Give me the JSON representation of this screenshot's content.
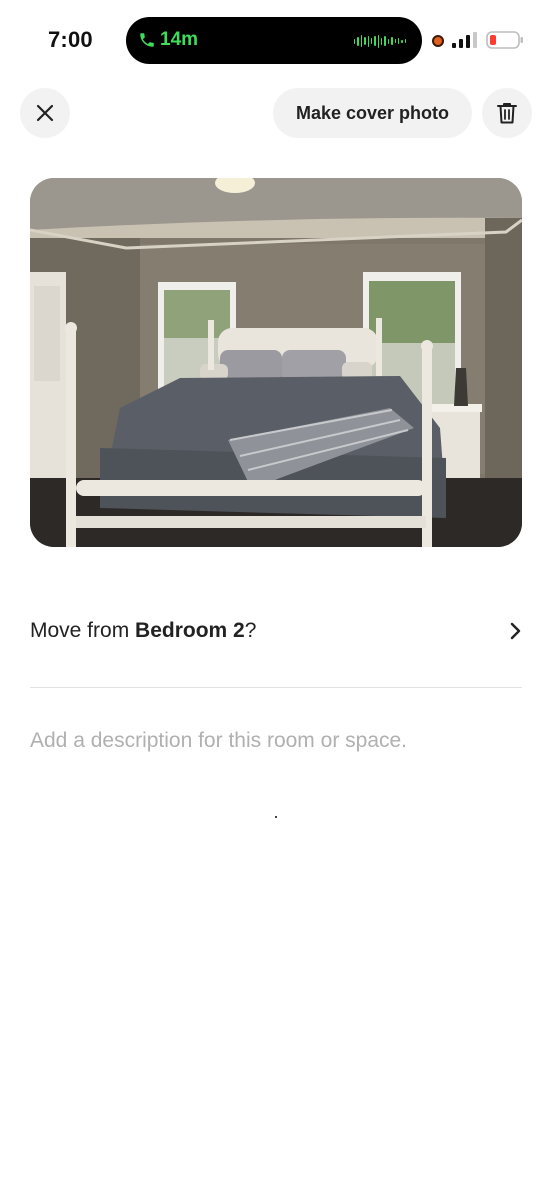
{
  "status_bar": {
    "time": "7:00",
    "call_duration": "14m",
    "call_color": "#3ddc5a",
    "battery_color": "#ff3b30"
  },
  "top_bar": {
    "close_icon": "close-icon",
    "cover_button_label": "Make cover photo",
    "trash_icon": "trash-icon"
  },
  "photo": {
    "subject": "bedroom-photo"
  },
  "move_row": {
    "prefix": "Move from ",
    "room": "Bedroom 2",
    "suffix": "?",
    "chevron_icon": "chevron-right-icon"
  },
  "description": {
    "placeholder": "Add a description for this room or space.",
    "value": ""
  }
}
